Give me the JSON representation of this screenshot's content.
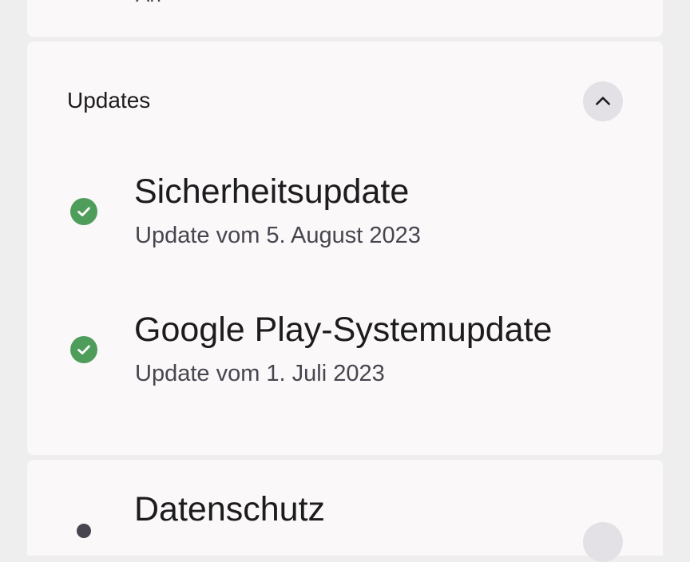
{
  "top_card": {
    "cut_text": "An"
  },
  "updates": {
    "title": "Updates",
    "collapse_icon": "chevron-up-icon",
    "items": [
      {
        "title": "Sicherheitsupdate",
        "subtitle": "Update vom 5. August 2023",
        "status_icon": "check-circle-icon"
      },
      {
        "title": "Google Play-Systemupdate",
        "subtitle": "Update vom 1. Juli 2023",
        "status_icon": "check-circle-icon"
      }
    ]
  },
  "privacy": {
    "title": "Datenschutz"
  },
  "colors": {
    "background": "#efeeef",
    "card": "#faf8f9",
    "success": "#4f9d5b",
    "button": "#e3e1e5",
    "text_primary": "#1c1b1d",
    "text_secondary": "#49454f"
  }
}
